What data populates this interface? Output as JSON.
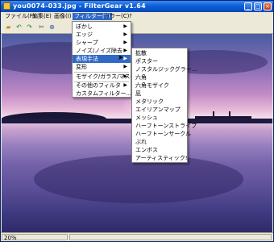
{
  "window": {
    "title": "you0074-033.jpg - FilterGear v1.64",
    "minimize": "_",
    "maximize": "□",
    "close": "×"
  },
  "menubar": {
    "items": [
      "ファイル(F)",
      "編集(E)",
      "画像(I)",
      "フィルター(T)",
      "カラー(C)",
      "?"
    ]
  },
  "filter_menu": {
    "items": [
      "ぼかし",
      "エッジ",
      "シャープ",
      "ノイズ/ノイズ除去",
      "表現手法",
      "変形",
      "モザイク/ガラス/マスク",
      "その他のフィルタ",
      "カスタムフィルター..."
    ],
    "highlighted": "表現手法"
  },
  "submenu": {
    "items": [
      "拡散",
      "ポスター",
      "ノスタルジックグラー...",
      "六角",
      "六角モザイク",
      "凪",
      "メタリック",
      "エイリアンマップ",
      "メッシュ",
      "ハーフトーンストライプ",
      "ハーフトーンサークル",
      "ぶれ",
      "エンボス",
      "アーティスティック!"
    ]
  },
  "status": {
    "zoom": "20%"
  }
}
